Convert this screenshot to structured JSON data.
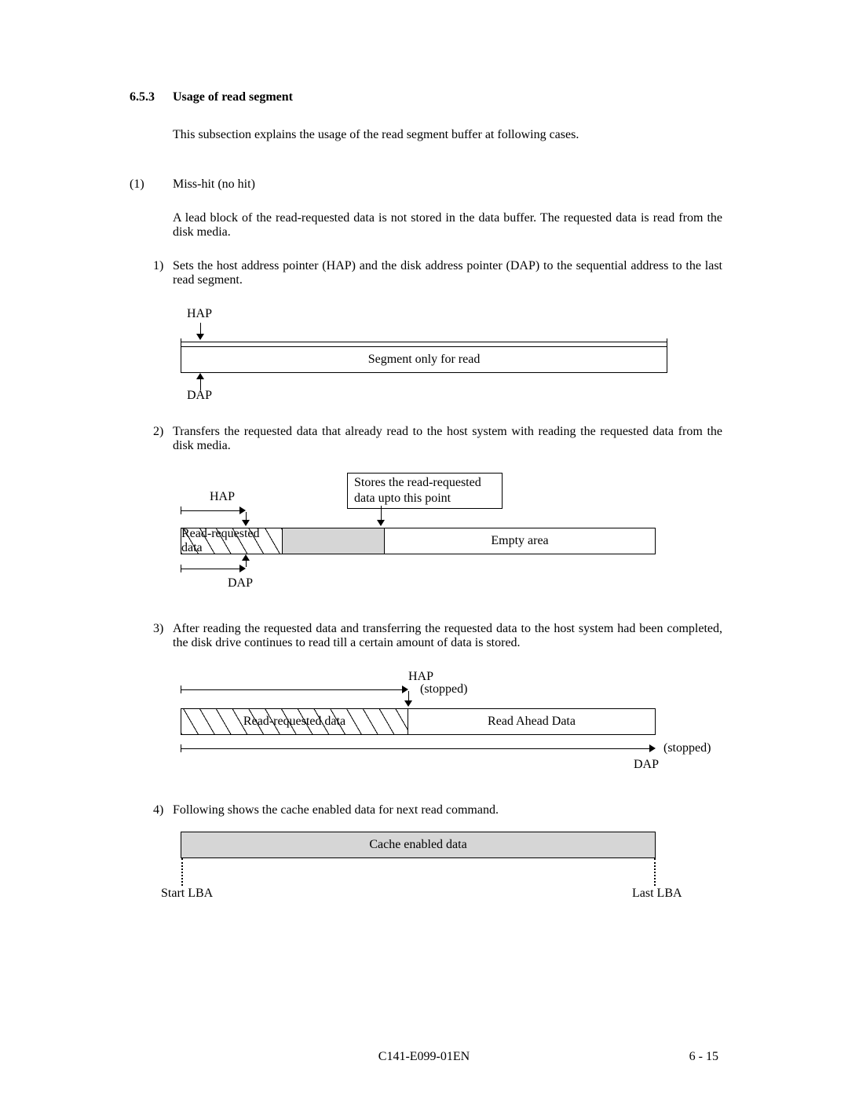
{
  "section": {
    "number": "6.5.3",
    "title": "Usage of read segment"
  },
  "lead": "This subsection explains the usage of the read segment buffer at following cases.",
  "item1": {
    "num": "(1)",
    "title": "Miss-hit (no hit)",
    "desc": "A lead block of the read-requested data is not stored in the data buffer.  The requested data is read from the disk media."
  },
  "step1": {
    "num": "1)",
    "text": "Sets the host address pointer (HAP) and the disk address pointer (DAP) to the sequential address to the last read segment."
  },
  "d1": {
    "hap": "HAP",
    "dap": "DAP",
    "box": "Segment only for read"
  },
  "step2": {
    "num": "2)",
    "text": "Transfers the requested data that already read to the host system with reading the requested data from the disk media."
  },
  "d2": {
    "hap": "HAP",
    "dap": "DAP",
    "note": "Stores the read-requested data upto this point",
    "seg1": "Read-requested data",
    "seg3": "Empty area"
  },
  "step3": {
    "num": "3)",
    "text": "After reading the requested data and transferring the requested data to the host system had been completed, the disk drive continues to read till a certain amount of data is stored."
  },
  "d3": {
    "hap": "HAP",
    "dap": "DAP",
    "stopped": "(stopped)",
    "seg1": "Read-requested data",
    "seg2": "Read Ahead Data"
  },
  "step4": {
    "num": "4)",
    "text": "Following shows the cache enabled data for next read command."
  },
  "d4": {
    "box": "Cache enabled data",
    "start": "Start LBA",
    "last": "Last LBA"
  },
  "footer": {
    "docid": "C141-E099-01EN",
    "page": "6 - 15"
  }
}
